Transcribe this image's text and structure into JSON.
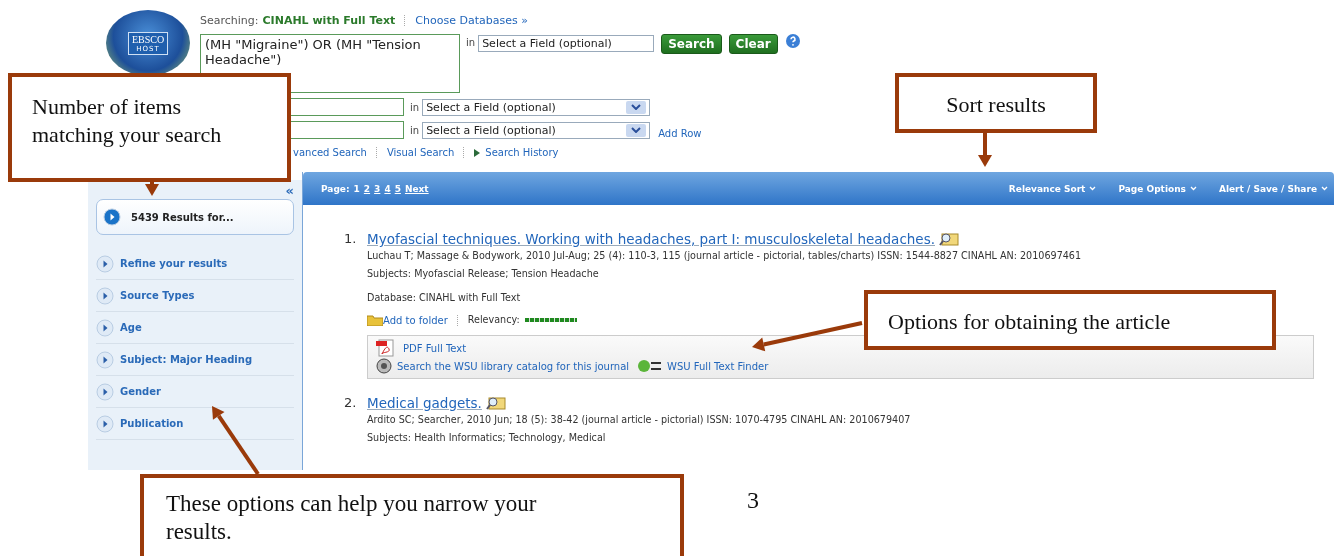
{
  "logo": {
    "title": "EBSCO",
    "subtitle": "HOST"
  },
  "search": {
    "searching_label": "Searching:",
    "database": "CINAHL with Full Text",
    "choose_link": "Choose Databases »",
    "query": "(MH \"Migraine\") OR (MH \"Tension Headache\")",
    "in_label": "in",
    "field_select": "Select a Field (optional)",
    "search_button": "Search",
    "clear_button": "Clear"
  },
  "extra_rows": [
    {
      "in_label": "in",
      "field_select": "Select a Field (optional)"
    },
    {
      "in_label": "in",
      "field_select": "Select a Field (optional)",
      "add_row": "Add Row"
    }
  ],
  "links": [
    {
      "label": "vanced Search",
      "kind": "plain"
    },
    {
      "label": "Visual Search",
      "kind": "plain"
    },
    {
      "label": "Search History",
      "kind": "expand"
    }
  ],
  "sidebar": {
    "collapse": "«",
    "results": "5439 Results for...",
    "facets": [
      "Refine your results",
      "Source Types",
      "Age",
      "Subject: Major Heading",
      "Gender",
      "Publication"
    ]
  },
  "toolbar": {
    "page_label": "Page:",
    "pages": [
      {
        "label": "1",
        "selected": true
      },
      {
        "label": "2",
        "selected": false
      },
      {
        "label": "3",
        "selected": false
      },
      {
        "label": "4",
        "selected": false
      },
      {
        "label": "5",
        "selected": false
      }
    ],
    "next": "Next",
    "menus": [
      "Relevance Sort",
      "Page Options",
      "Alert / Save / Share"
    ]
  },
  "results": [
    {
      "number": "1.",
      "title": "Myofascial techniques. Working with headaches, part I: musculoskeletal headaches.",
      "details": "Luchau T; Massage & Bodywork, 2010 Jul-Aug; 25 (4): 110-3, 115 (journal article - pictorial, tables/charts) ISSN: 1544-8827 CINAHL AN: 2010697461",
      "subjects": "Subjects: Myofascial Release; Tension Headache",
      "database": "Database: CINAHL with Full Text",
      "add_to_folder": "Add to folder",
      "relevancy_label": "Relevancy:",
      "relevancy": {
        "level": 1
      },
      "options": [
        {
          "kind": "pdf",
          "label": "PDF Full Text"
        },
        {
          "kind": "catalog",
          "label": "Search the WSU library catalog for this journal"
        },
        {
          "kind": "link360",
          "label": "WSU Full Text Finder"
        }
      ]
    },
    {
      "number": "2.",
      "title": "Medical gadgets.",
      "details": "Ardito SC; Searcher, 2010 Jun; 18 (5): 38-42 (journal article - pictorial) ISSN: 1070-4795 CINAHL AN: 2010679407",
      "subjects": "Subjects: Health Informatics; Technology, Medical"
    }
  ],
  "callouts": [
    "Number of items matching your search",
    "Sort results",
    "Options for obtaining the article",
    "These options can help you narrow your results."
  ],
  "page_number": "3"
}
